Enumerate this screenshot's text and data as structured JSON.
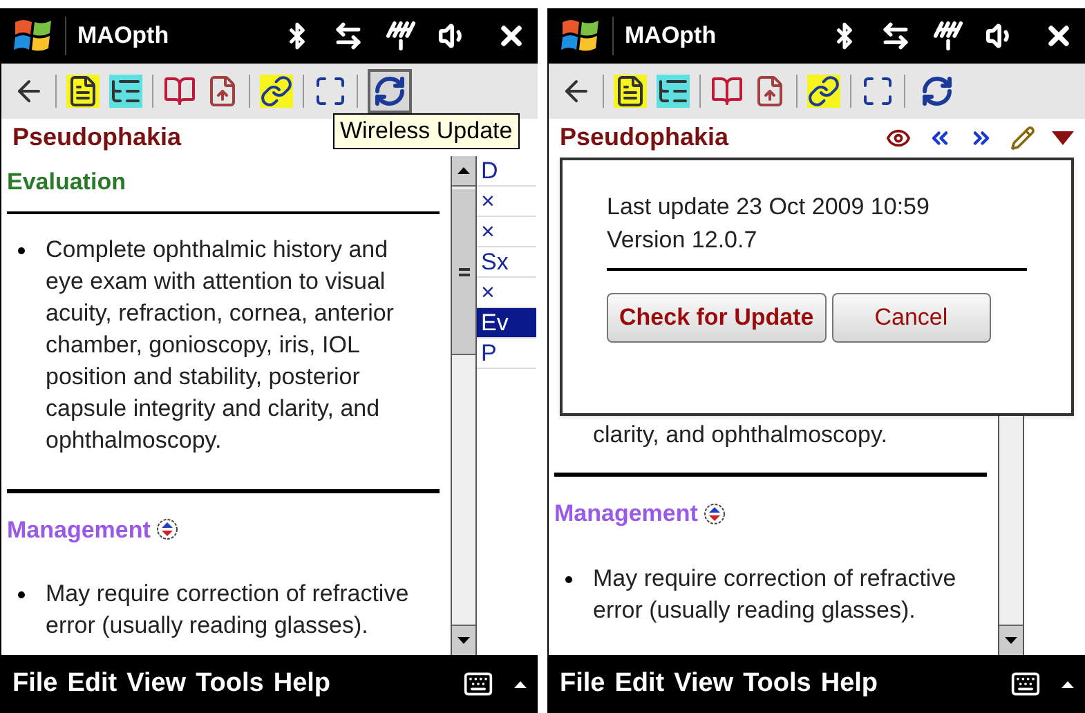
{
  "screens": [
    {
      "title": "MAOpth",
      "sync_pressed": true,
      "tooltip": "Wireless Update",
      "topic": "Pseudophakia",
      "sections": [
        {
          "heading": "Evaluation",
          "kind": "evaluation",
          "items": [
            {
              "kind": "bullet",
              "text": "Complete ophthalmic history and eye exam with attention to visual acuity, refraction, cornea, anterior chamber, gonioscopy, iris, IOL position and stability, posterior capsule integrity and clarity, and ophthalmoscopy."
            }
          ]
        },
        {
          "heading": "Management",
          "kind": "management",
          "items": [
            {
              "kind": "bullet",
              "text": "May require correction of refractive error (usually reading glasses)."
            }
          ]
        }
      ],
      "index": [
        {
          "label": "D",
          "selected": false
        },
        {
          "label": "×",
          "selected": false
        },
        {
          "label": "×",
          "selected": false
        },
        {
          "label": "Sx",
          "selected": false
        },
        {
          "label": "×",
          "selected": false
        },
        {
          "label": "Ev",
          "selected": true
        },
        {
          "label": "P",
          "selected": false
        }
      ],
      "menu": [
        "File",
        "Edit",
        "View",
        "Tools",
        "Help"
      ]
    },
    {
      "title": "MAOpth",
      "sync_pressed": false,
      "topic": "Pseudophakia",
      "nav_tools": true,
      "dialog": {
        "lines": [
          "Last update 23 Oct 2009 10:59",
          "Version 12.0.7"
        ],
        "buttons": [
          {
            "label": "Check for Update",
            "kind": "primary"
          },
          {
            "label": "Cancel",
            "kind": "secondary"
          }
        ]
      },
      "sections": [
        {
          "kind": "evaluation",
          "items": [
            {
              "kind": "continuation",
              "text": "clarity, and ophthalmoscopy."
            }
          ]
        },
        {
          "heading": "Management",
          "kind": "management",
          "items": [
            {
              "kind": "bullet",
              "text": "May require correction of refractive error (usually reading glasses)."
            }
          ]
        }
      ],
      "menu": [
        "File",
        "Edit",
        "View",
        "Tools",
        "Help"
      ]
    }
  ]
}
